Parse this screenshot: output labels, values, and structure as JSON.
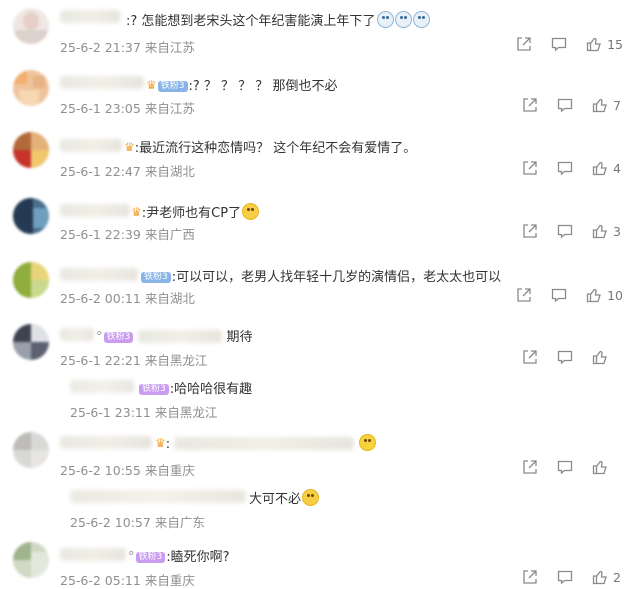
{
  "comments": [
    {
      "text": ":?  怎能想到老宋头这个年纪害能演上年下了",
      "emojis": 3,
      "date": "25-6-2 21:37",
      "loc": "来自江苏",
      "likes": "15"
    },
    {
      "badge": "铁粉3",
      "text": ":? ？ ？ ？ ？  那倒也不必",
      "date": "25-6-1 23:05",
      "loc": "来自江苏",
      "likes": "7"
    },
    {
      "text": ":最近流行这种恋情吗？ 这个年纪不会有爱情了。",
      "date": "25-6-1 22:47",
      "loc": "来自湖北",
      "likes": "4"
    },
    {
      "text": ":尹老师也有CP了",
      "date": "25-6-1 22:39",
      "loc": "来自广西",
      "likes": "3"
    },
    {
      "badge": "铁粉3",
      "text": ":可以可以，老男人找年轻十几岁的演情侣，老太太也可以",
      "date": "25-6-2 00:11",
      "loc": "来自湖北",
      "likes": "10"
    },
    {
      "badge": "铁粉3",
      "text": "期待",
      "date": "25-6-1 22:21",
      "loc": "来自黑龙江",
      "likes": ""
    },
    {
      "badge": "铁粉3",
      "text": ":哈哈哈很有趣",
      "date": "25-6-1 23:11",
      "loc": "来自黑龙江"
    },
    {
      "text": ":",
      "date": "25-6-2 10:55",
      "loc": "来自重庆",
      "likes": ""
    },
    {
      "text": "大可不必",
      "date": "25-6-2 10:57",
      "loc": "来自广东"
    },
    {
      "badge": "铁粉3",
      "text": ":瞌死你啊?",
      "date": "25-6-2 05:11",
      "loc": "来自重庆",
      "likes": "2"
    }
  ],
  "colors": {
    "meta": "#8f8f8f",
    "text": "#333333",
    "icon": "#8a8a8a"
  }
}
